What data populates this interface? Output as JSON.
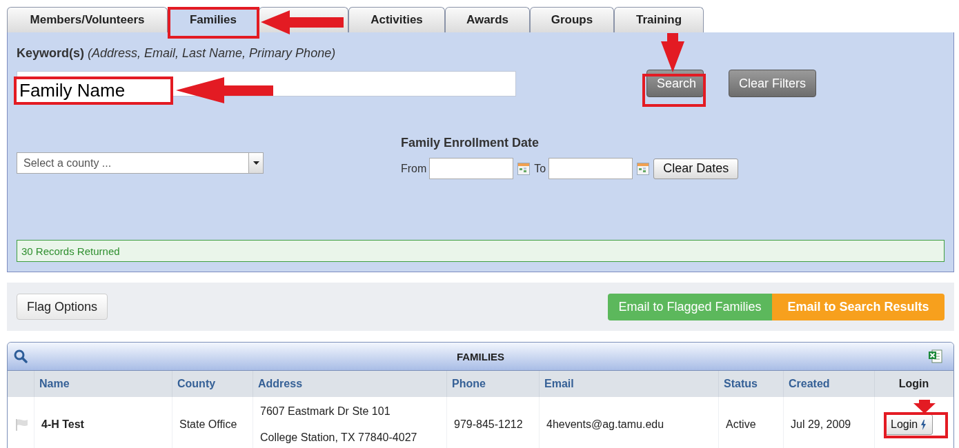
{
  "tabs": [
    {
      "label": "Members/Volunteers",
      "selected": false
    },
    {
      "label": "Families",
      "selected": true
    },
    {
      "selected": false
    },
    {
      "label": "Activities",
      "selected": false
    },
    {
      "label": "Awards",
      "selected": false
    },
    {
      "label": "Groups",
      "selected": false
    },
    {
      "label": "Training",
      "selected": false
    }
  ],
  "keyword": {
    "label": "Keyword(s)",
    "hint": "(Address, Email, Last Name, Primary Phone)"
  },
  "annotation_label": "Family Name",
  "search_button": "Search",
  "clear_filters_button": "Clear Filters",
  "county_select": {
    "placeholder": "Select a county ..."
  },
  "enrollment": {
    "title": "Family Enrollment Date",
    "from_label": "From",
    "to_label": "To",
    "clear_button": "Clear Dates"
  },
  "status_message": "30 Records Returned",
  "flag_options_button": "Flag Options",
  "email_flagged_button": "Email to Flagged Families",
  "email_results_button": "Email to Search Results",
  "table": {
    "title": "FAMILIES",
    "columns": [
      "Name",
      "County",
      "Address",
      "Phone",
      "Email",
      "Status",
      "Created",
      "Login"
    ],
    "rows": [
      {
        "flagged": false,
        "name": "4-H Test",
        "county": "State Office",
        "address": [
          "7607 Eastmark Dr Ste 101",
          "College Station, TX 77840-4027"
        ],
        "phone": "979-845-1212",
        "email": "4hevents@ag.tamu.edu",
        "status": "Active",
        "created": "Jul 29, 2009",
        "login": "Login"
      }
    ]
  }
}
